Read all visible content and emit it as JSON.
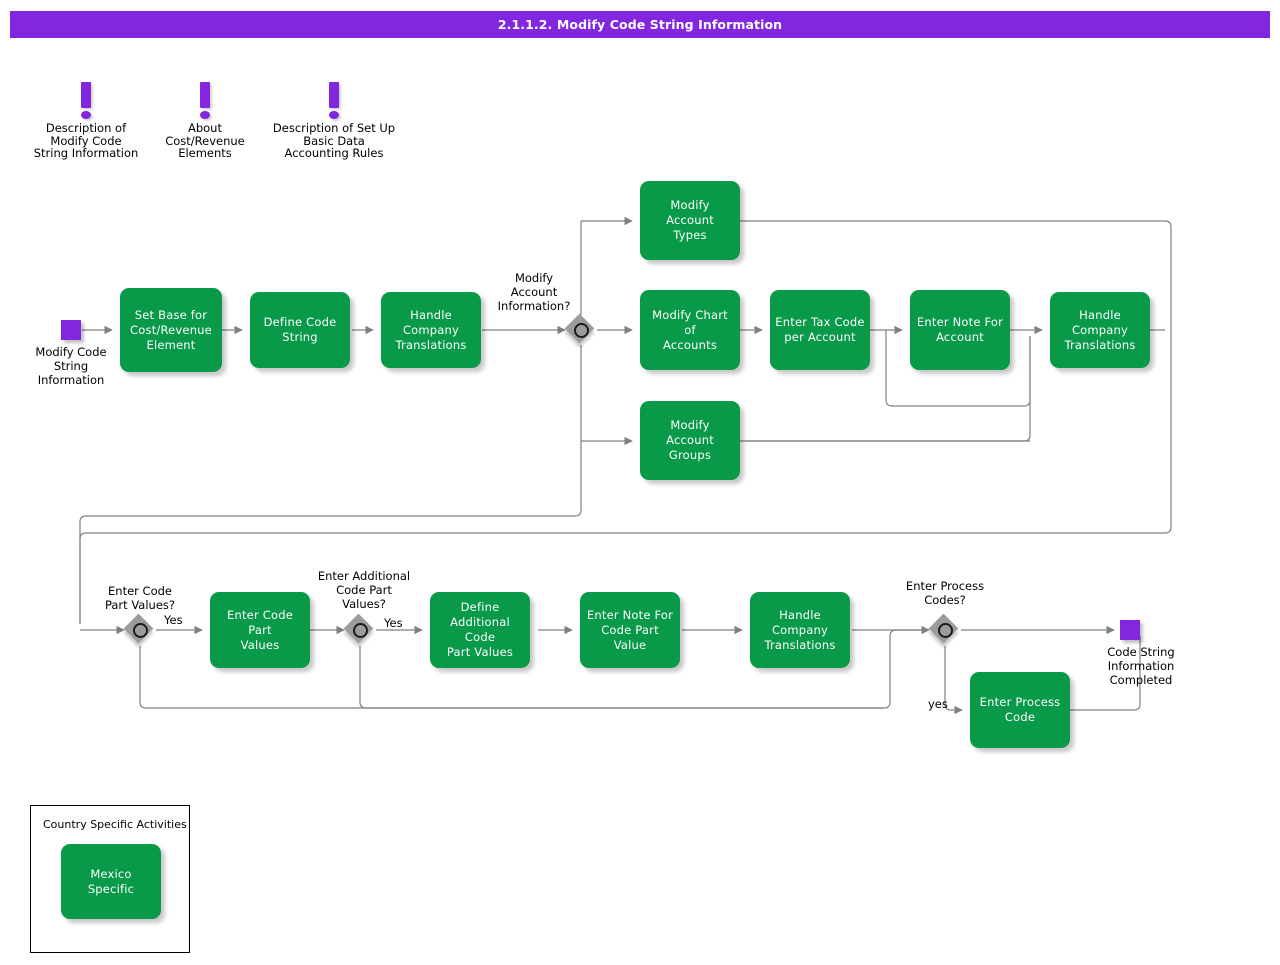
{
  "header": {
    "title": "2.1.1.2. Modify Code String Information"
  },
  "annotations": [
    {
      "icon": "exclamation-icon",
      "text": "Description of\nModify Code\nString Information"
    },
    {
      "icon": "exclamation-icon",
      "text": "About\nCost/Revenue\nElements"
    },
    {
      "icon": "exclamation-icon",
      "text": "Description of Set Up\nBasic Data\nAccounting Rules"
    }
  ],
  "events": [
    {
      "type": "start-event",
      "label": "Modify Code\nString\nInformation"
    },
    {
      "type": "end-event",
      "label": "Code String\nInformation\nCompleted"
    }
  ],
  "tasks": [
    {
      "id": "set-base-cost-revenue-element",
      "label": "Set Base for\nCost/Revenue\nElement"
    },
    {
      "id": "define-code-string",
      "label": "Define Code\nString"
    },
    {
      "id": "handle-company-translations-1",
      "label": "Handle\nCompany\nTranslations"
    },
    {
      "id": "modify-account-types",
      "label": "Modify Account\nTypes"
    },
    {
      "id": "modify-chart-of-accounts",
      "label": "Modify Chart of\nAccounts"
    },
    {
      "id": "enter-tax-code-per-account",
      "label": "Enter Tax Code\nper Account"
    },
    {
      "id": "enter-note-for-account",
      "label": "Enter Note For\nAccount"
    },
    {
      "id": "handle-company-translations-2",
      "label": "Handle\nCompany\nTranslations"
    },
    {
      "id": "modify-account-groups",
      "label": "Modify Account\nGroups"
    },
    {
      "id": "enter-code-part-values",
      "label": "Enter Code Part\nValues"
    },
    {
      "id": "define-additional-code-part-values",
      "label": "Define\nAdditional Code\nPart Values"
    },
    {
      "id": "enter-note-for-code-part-value",
      "label": "Enter Note For\nCode Part Value"
    },
    {
      "id": "handle-company-translations-3",
      "label": "Handle\nCompany\nTranslations"
    },
    {
      "id": "enter-process-code",
      "label": "Enter Process\nCode"
    },
    {
      "id": "mexico-specific",
      "label": "Mexico Specific"
    }
  ],
  "gateways": [
    {
      "id": "modify-account-information",
      "label": "Modify\nAccount\nInformation?"
    },
    {
      "id": "enter-code-part-values",
      "label": "Enter Code\nPart Values?"
    },
    {
      "id": "enter-additional-code-part-values",
      "label": "Enter Additional\nCode Part\nValues?"
    },
    {
      "id": "enter-process-codes",
      "label": "Enter Process\nCodes?"
    }
  ],
  "flow_labels": [
    {
      "id": "yes-code-part-values",
      "text": "Yes"
    },
    {
      "id": "yes-additional-code-part-values",
      "text": "Yes"
    },
    {
      "id": "yes-process-codes",
      "text": "yes"
    }
  ],
  "legend": {
    "title": "Country Specific Activities",
    "item_label": "Mexico Specific"
  },
  "colors": {
    "accent_purple": "#8226e0",
    "task_green": "#089949",
    "gateway_gray": "#9c9c9c",
    "connector_gray": "#808080",
    "text_white": "#ffffff",
    "text_black": "#000000"
  }
}
